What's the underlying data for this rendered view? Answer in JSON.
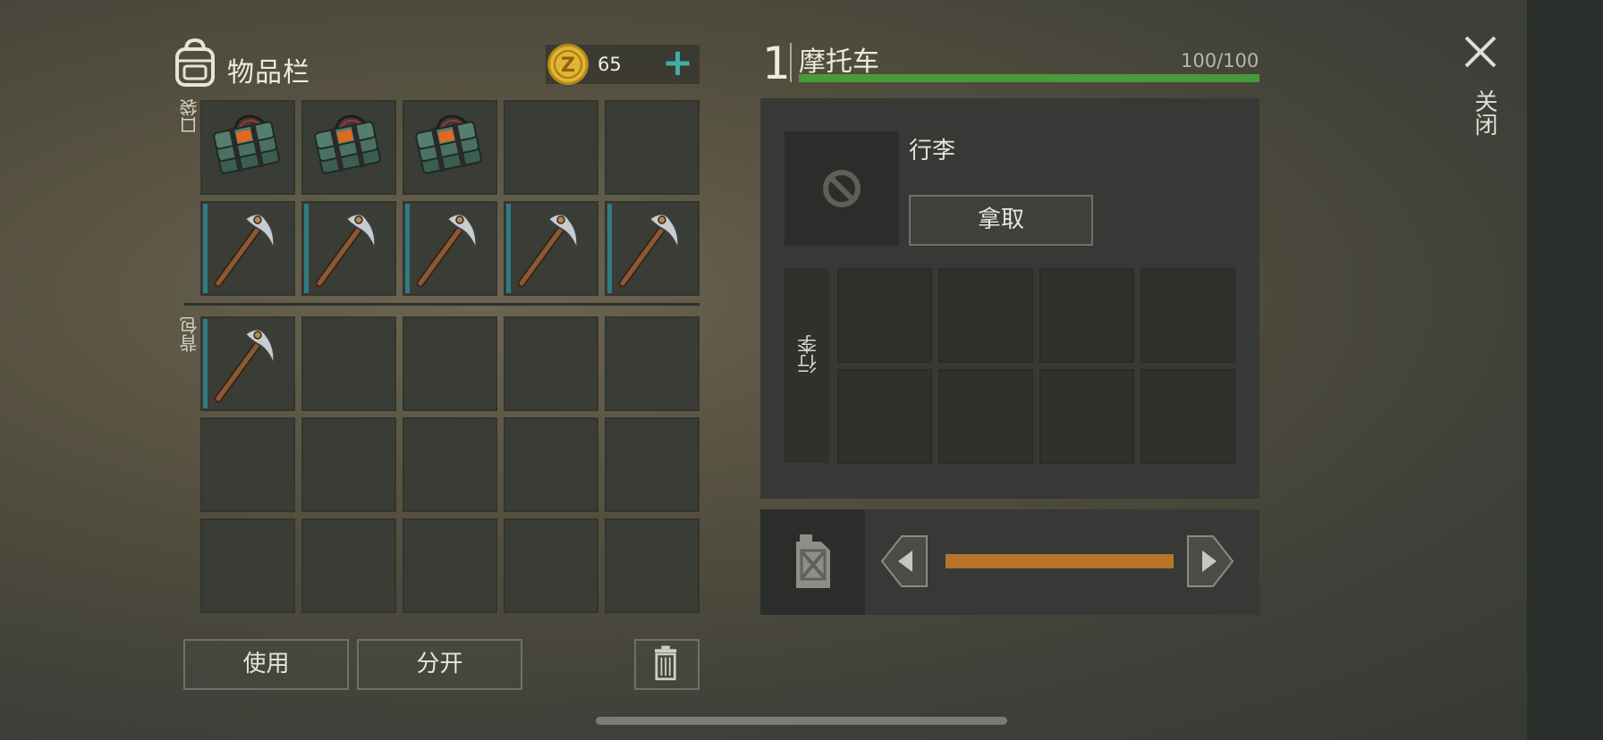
{
  "inventory": {
    "title": "物品栏",
    "coins": "65",
    "add_coins_label": "+",
    "pocket_label": "口袋",
    "backpack_label": "背包",
    "pocket_slots": [
      "explosive",
      "explosive",
      "explosive",
      "",
      "",
      "pickaxe",
      "pickaxe",
      "pickaxe",
      "pickaxe",
      "pickaxe"
    ],
    "backpack_slots": [
      "pickaxe",
      "",
      "",
      "",
      "",
      "",
      "",
      "",
      "",
      "",
      "",
      "",
      "",
      "",
      ""
    ],
    "use_label": "使用",
    "split_label": "分开",
    "trash_icon": "trash-icon"
  },
  "vehicle": {
    "number": "1",
    "name": "摩托车",
    "hp_text": "100/100",
    "hp_fraction": 1.0,
    "trunk_title": "行李",
    "take_label": "拿取",
    "trunk_side_label": "行李",
    "trunk_slots": [
      "",
      "",
      "",
      "",
      "",
      "",
      "",
      ""
    ],
    "fuel_fraction": 1.0
  },
  "close_label": "关闭",
  "colors": {
    "accent_teal": "#3fb0a6",
    "hp_green": "#4a9a3a",
    "fuel_orange": "#b6752b"
  }
}
